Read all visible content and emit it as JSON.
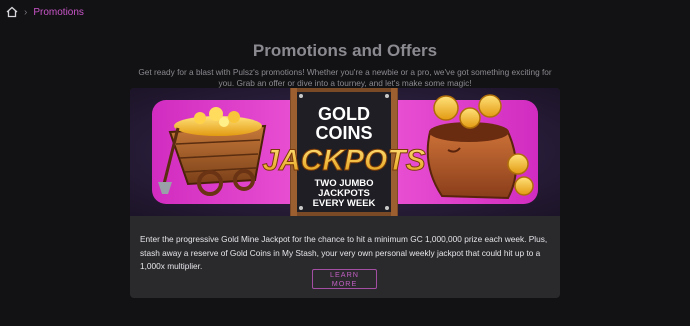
{
  "breadcrumb": {
    "current": "Promotions"
  },
  "page": {
    "title": "Promotions and Offers",
    "intro": "Get ready for a blast with Pulsz's promotions! Whether you're a newbie or a pro, we've got something exciting for you. Grab an offer or dive into a tourney, and let's make some magic!"
  },
  "promo": {
    "banner": {
      "line1": "GOLD",
      "line2": "COINS",
      "headline": "JACKPOTS",
      "sub1": "TWO JUMBO",
      "sub2": "JACKPOTS",
      "sub3": "EVERY WEEK"
    },
    "description": "Enter the progressive Gold Mine Jackpot for the chance to hit a minimum GC 1,000,000 prize each week. Plus, stash away a reserve of Gold Coins in My Stash, your very own personal weekly jackpot that could hit up to a 1,000x multiplier.",
    "cta_label": "LEARN MORE"
  },
  "colors": {
    "accent": "#c955c9",
    "banner_pink": "#e63fc7",
    "gold": "#f5b92a"
  }
}
